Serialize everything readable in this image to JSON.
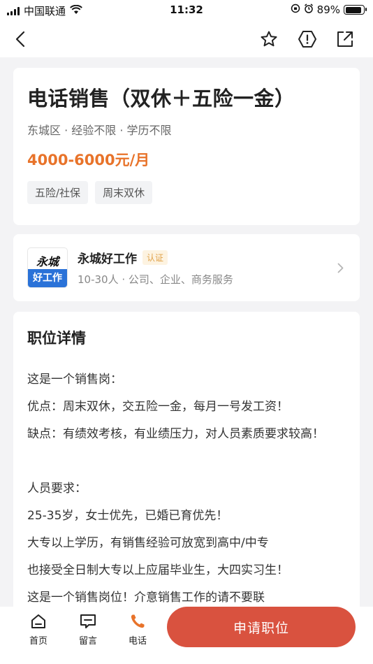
{
  "status_bar": {
    "carrier": "中国联通",
    "time": "11:32",
    "battery_percent": "89%",
    "battery_level": 0.89,
    "icons": [
      "signal-icon",
      "wifi-icon",
      "orientation-lock-icon",
      "alarm-icon",
      "battery-icon"
    ]
  },
  "nav": {
    "icons": [
      "back-icon",
      "star-icon",
      "report-icon",
      "share-icon"
    ]
  },
  "job": {
    "title": "电话销售（双休＋五险一金）",
    "meta": "东城区 · 经验不限 · 学历不限",
    "salary": "4000-6000元/月",
    "tags": [
      "五险/社保",
      "周末双休"
    ]
  },
  "company": {
    "logo_text": "永城",
    "logo_banner": "好工作",
    "name": "永城好工作",
    "badge": "认证",
    "meta": "10-30人 · 公司、企业、商务服务"
  },
  "detail": {
    "title": "职位详情",
    "lines": [
      "这是一个销售岗：",
      "优点：周末双休，交五险一金，每月一号发工资！",
      "缺点：有绩效考核，有业绩压力，对人员素质要求较高！",
      "",
      "人员要求：",
      "25-35岁，女士优先，已婚已育优先！",
      "大专以上学历，有销售经验可放宽到高中/中专",
      "也接受全日制大专以上应届毕业生，大四实习生！",
      "这是一个销售岗位！介意销售工作的请不要联"
    ]
  },
  "bottom_bar": {
    "home": "首页",
    "message": "留言",
    "phone": "电话",
    "apply": "申请职位"
  },
  "colors": {
    "accent": "#e8732a",
    "apply_button": "#d9523f",
    "logo_blue": "#2a72d8",
    "badge_bg": "#fdf3e1",
    "badge_text": "#e0a24a"
  }
}
